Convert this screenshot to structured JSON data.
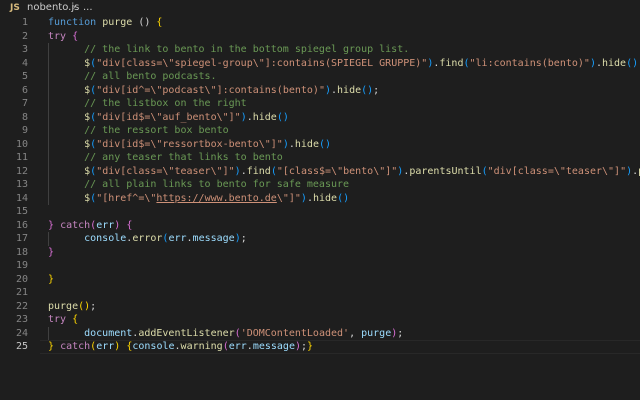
{
  "breadcrumb": {
    "lang_badge": "JS",
    "file_name": "nobento.js",
    "separator": "›",
    "more": "..."
  },
  "editor": {
    "active_line": 25,
    "lines": [
      {
        "n": "1",
        "tokens": [
          [
            "kw",
            "function "
          ],
          [
            "fn",
            "purge"
          ],
          [
            "pun",
            " () "
          ],
          [
            "br1",
            "{"
          ]
        ]
      },
      {
        "n": "2",
        "tokens": [
          [
            "ctl",
            "try "
          ],
          [
            "br2",
            "{"
          ]
        ]
      },
      {
        "n": "3",
        "tokens": [
          [
            "pun",
            "      "
          ],
          [
            "cm",
            "// the link to bento in the bottom spiegel group list."
          ]
        ]
      },
      {
        "n": "4",
        "tokens": [
          [
            "pun",
            "      "
          ],
          [
            "fn",
            "$"
          ],
          [
            "br3",
            "("
          ],
          [
            "str",
            "\"div[class=\\\"spiegel-group\\\"]:contains(SPIEGEL GRUPPE)\""
          ],
          [
            "br3",
            ")"
          ],
          [
            "pun",
            "."
          ],
          [
            "fn",
            "find"
          ],
          [
            "br3",
            "("
          ],
          [
            "str",
            "\"li:contains(bento)\""
          ],
          [
            "br3",
            ")"
          ],
          [
            "pun",
            "."
          ],
          [
            "fn",
            "hide"
          ],
          [
            "br3",
            "()"
          ],
          [
            "pun",
            ";"
          ]
        ]
      },
      {
        "n": "5",
        "tokens": [
          [
            "pun",
            "      "
          ],
          [
            "cm",
            "// all bento podcasts."
          ]
        ]
      },
      {
        "n": "6",
        "tokens": [
          [
            "pun",
            "      "
          ],
          [
            "fn",
            "$"
          ],
          [
            "br3",
            "("
          ],
          [
            "str",
            "\"div[id^=\\\"podcast\\\"]:contains(bento)\""
          ],
          [
            "br3",
            ")"
          ],
          [
            "pun",
            "."
          ],
          [
            "fn",
            "hide"
          ],
          [
            "br3",
            "()"
          ],
          [
            "pun",
            ";"
          ]
        ]
      },
      {
        "n": "7",
        "tokens": [
          [
            "pun",
            "      "
          ],
          [
            "cm",
            "// the listbox on the right"
          ]
        ]
      },
      {
        "n": "8",
        "tokens": [
          [
            "pun",
            "      "
          ],
          [
            "fn",
            "$"
          ],
          [
            "br3",
            "("
          ],
          [
            "str",
            "\"div[id$=\\\"auf_bento\\\"]\""
          ],
          [
            "br3",
            ")"
          ],
          [
            "pun",
            "."
          ],
          [
            "fn",
            "hide"
          ],
          [
            "br3",
            "()"
          ]
        ]
      },
      {
        "n": "9",
        "tokens": [
          [
            "pun",
            "      "
          ],
          [
            "cm",
            "// the ressort box bento"
          ]
        ]
      },
      {
        "n": "10",
        "tokens": [
          [
            "pun",
            "      "
          ],
          [
            "fn",
            "$"
          ],
          [
            "br3",
            "("
          ],
          [
            "str",
            "\"div[id$=\\\"ressortbox-bento\\\"]\""
          ],
          [
            "br3",
            ")"
          ],
          [
            "pun",
            "."
          ],
          [
            "fn",
            "hide"
          ],
          [
            "br3",
            "()"
          ]
        ]
      },
      {
        "n": "11",
        "tokens": [
          [
            "pun",
            "      "
          ],
          [
            "cm",
            "// any teaser that links to bento"
          ]
        ]
      },
      {
        "n": "12",
        "tokens": [
          [
            "pun",
            "      "
          ],
          [
            "fn",
            "$"
          ],
          [
            "br3",
            "("
          ],
          [
            "str",
            "\"div[class=\\\"teaser\\\"]\""
          ],
          [
            "br3",
            ")"
          ],
          [
            "pun",
            "."
          ],
          [
            "fn",
            "find"
          ],
          [
            "br3",
            "("
          ],
          [
            "str",
            "\"[class$=\\\"bento\\\"]\""
          ],
          [
            "br3",
            ")"
          ],
          [
            "pun",
            "."
          ],
          [
            "fn",
            "parentsUntil"
          ],
          [
            "br3",
            "("
          ],
          [
            "str",
            "\"div[class=\\\"teaser\\\"]\""
          ],
          [
            "br3",
            ")"
          ],
          [
            "pun",
            "."
          ],
          [
            "fn",
            "parent"
          ],
          [
            "br3",
            "()"
          ],
          [
            "pun",
            "."
          ],
          [
            "fn",
            "hide"
          ],
          [
            "br3",
            "()"
          ],
          [
            "pun",
            ";"
          ]
        ]
      },
      {
        "n": "13",
        "tokens": [
          [
            "pun",
            "      "
          ],
          [
            "cm",
            "// all plain links to bento for safe measure"
          ]
        ]
      },
      {
        "n": "14",
        "tokens": [
          [
            "pun",
            "      "
          ],
          [
            "fn",
            "$"
          ],
          [
            "br3",
            "("
          ],
          [
            "str",
            "\"[href^=\\\""
          ],
          [
            "url",
            "https://www.bento.de"
          ],
          [
            "str",
            "\\\"]\""
          ],
          [
            "br3",
            ")"
          ],
          [
            "pun",
            "."
          ],
          [
            "fn",
            "hide"
          ],
          [
            "br3",
            "()"
          ]
        ]
      },
      {
        "n": "15",
        "tokens": []
      },
      {
        "n": "16",
        "tokens": [
          [
            "br2",
            "}"
          ],
          [
            "pun",
            " "
          ],
          [
            "ctl",
            "catch"
          ],
          [
            "br2",
            "("
          ],
          [
            "var",
            "err"
          ],
          [
            "br2",
            ")"
          ],
          [
            "pun",
            " "
          ],
          [
            "br2",
            "{"
          ]
        ]
      },
      {
        "n": "17",
        "tokens": [
          [
            "pun",
            "      "
          ],
          [
            "var",
            "console"
          ],
          [
            "pun",
            "."
          ],
          [
            "fn",
            "error"
          ],
          [
            "br3",
            "("
          ],
          [
            "var",
            "err"
          ],
          [
            "pun",
            "."
          ],
          [
            "var",
            "message"
          ],
          [
            "br3",
            ")"
          ],
          [
            "pun",
            ";"
          ]
        ]
      },
      {
        "n": "18",
        "tokens": [
          [
            "br2",
            "}"
          ]
        ]
      },
      {
        "n": "19",
        "tokens": []
      },
      {
        "n": "20",
        "tokens": [
          [
            "br1",
            "}"
          ]
        ]
      },
      {
        "n": "21",
        "tokens": []
      },
      {
        "n": "22",
        "tokens": [
          [
            "fn",
            "purge"
          ],
          [
            "br1",
            "()"
          ],
          [
            "pun",
            ";"
          ]
        ]
      },
      {
        "n": "23",
        "tokens": [
          [
            "ctl",
            "try "
          ],
          [
            "br1",
            "{"
          ]
        ]
      },
      {
        "n": "24",
        "tokens": [
          [
            "pun",
            "      "
          ],
          [
            "var",
            "document"
          ],
          [
            "pun",
            "."
          ],
          [
            "fn",
            "addEventListener"
          ],
          [
            "br2",
            "("
          ],
          [
            "str",
            "'DOMContentLoaded'"
          ],
          [
            "pun",
            ", "
          ],
          [
            "var",
            "purge"
          ],
          [
            "br2",
            ")"
          ],
          [
            "pun",
            ";"
          ]
        ]
      },
      {
        "n": "25",
        "tokens": [
          [
            "br1",
            "}"
          ],
          [
            "pun",
            " "
          ],
          [
            "ctl",
            "catch"
          ],
          [
            "br1",
            "("
          ],
          [
            "var",
            "err"
          ],
          [
            "br1",
            ")"
          ],
          [
            "pun",
            " "
          ],
          [
            "br1",
            "{"
          ],
          [
            "var",
            "console"
          ],
          [
            "pun",
            "."
          ],
          [
            "fn",
            "warning"
          ],
          [
            "br2",
            "("
          ],
          [
            "var",
            "err"
          ],
          [
            "pun",
            "."
          ],
          [
            "var",
            "message"
          ],
          [
            "br2",
            ")"
          ],
          [
            "pun",
            ";"
          ],
          [
            "br1",
            "}"
          ]
        ]
      }
    ]
  },
  "colors": {
    "background": "#1e1e1e",
    "keyword": "#569cd6",
    "control": "#c586c0",
    "function": "#dcdcaa",
    "string": "#ce9178",
    "comment": "#6a9955",
    "variable": "#9cdcfe"
  }
}
